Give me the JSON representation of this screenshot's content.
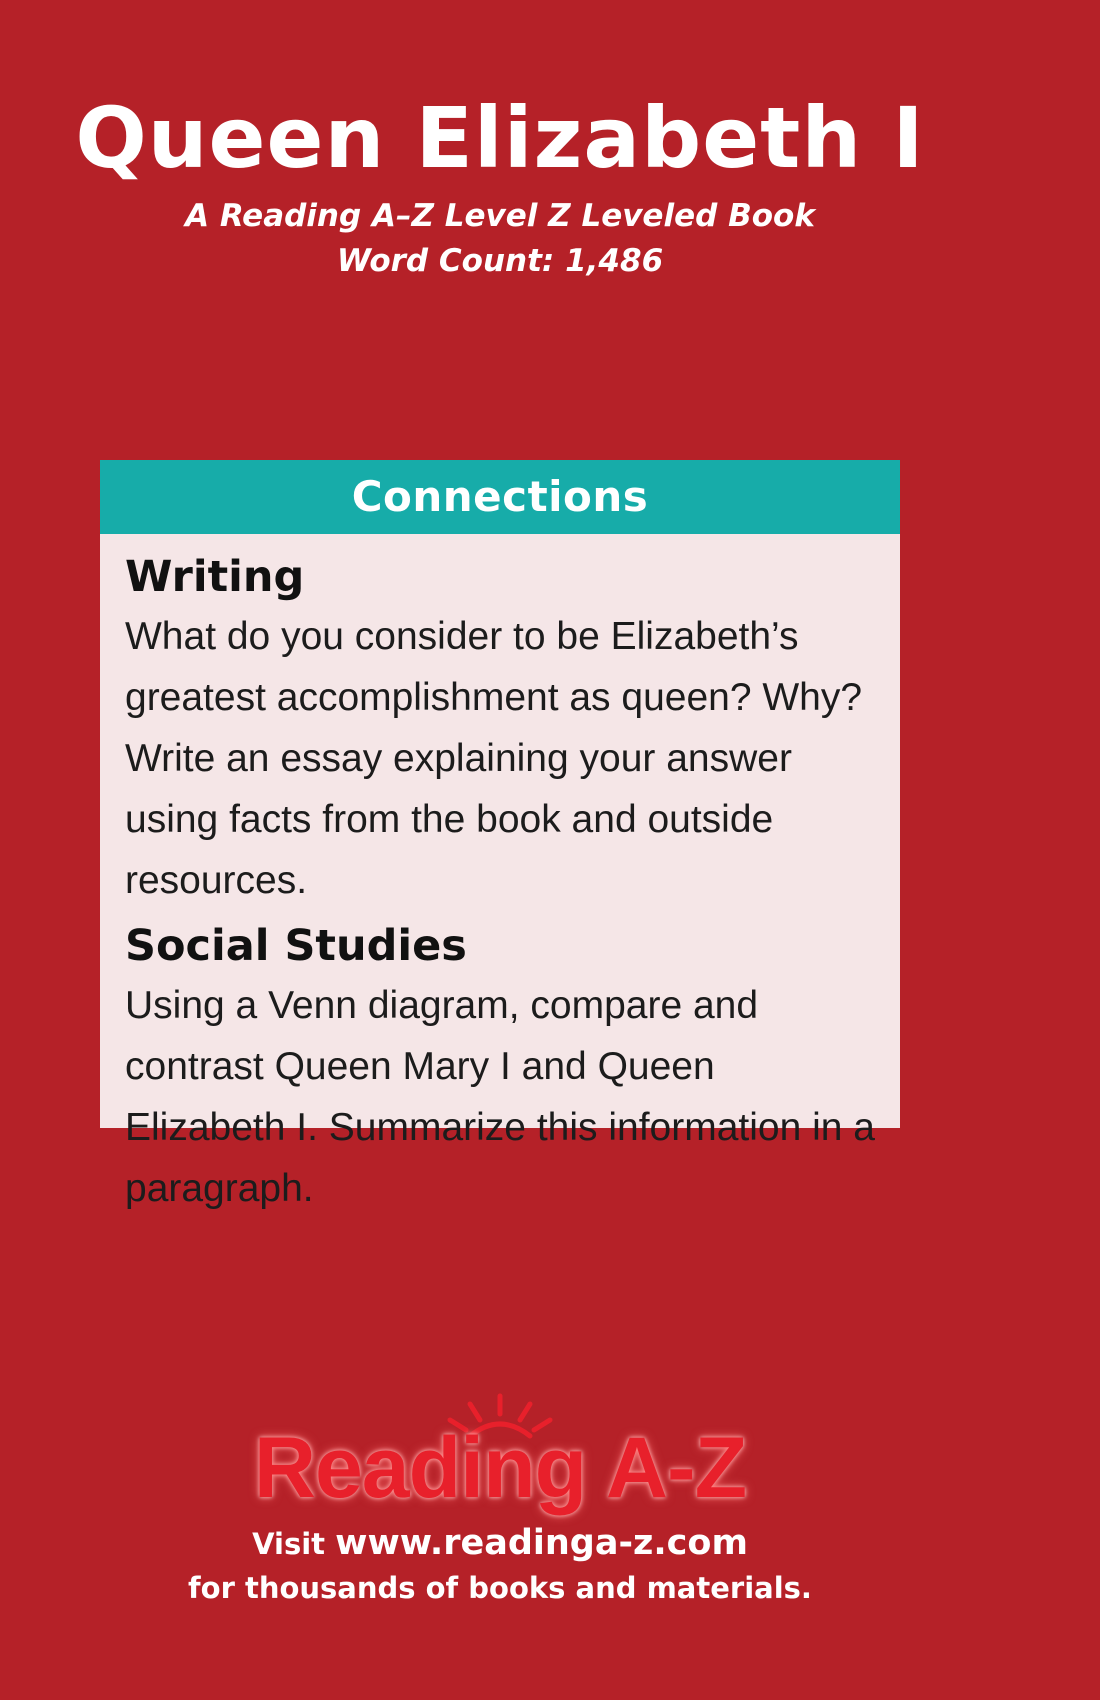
{
  "cover": {
    "title": "Queen Elizabeth I",
    "subtitle": "A Reading A–Z Level Z Leveled Book",
    "word_count": "Word Count: 1,486"
  },
  "connections": {
    "heading": "Connections",
    "writing": {
      "title": "Writing",
      "text": "What do you consider to be Elizabeth’s greatest accomplishment as queen? Why? Write an essay explaining your answer using facts from the book and outside resources."
    },
    "social_studies": {
      "title": "Social Studies",
      "text": "Using a Venn diagram, compare and contrast Queen Mary I and Queen Elizabeth I. Summarize this information in a paragraph."
    }
  },
  "footer": {
    "logo_text": "Reading A-Z",
    "visit_label": "Visit",
    "url": "www.readinga-z.com",
    "tagline": "for thousands of books and materials."
  },
  "colors": {
    "background": "#b52128",
    "header_bar": "#17aca9",
    "panel": "#f5e6e7",
    "logo_red": "#e8202b"
  }
}
